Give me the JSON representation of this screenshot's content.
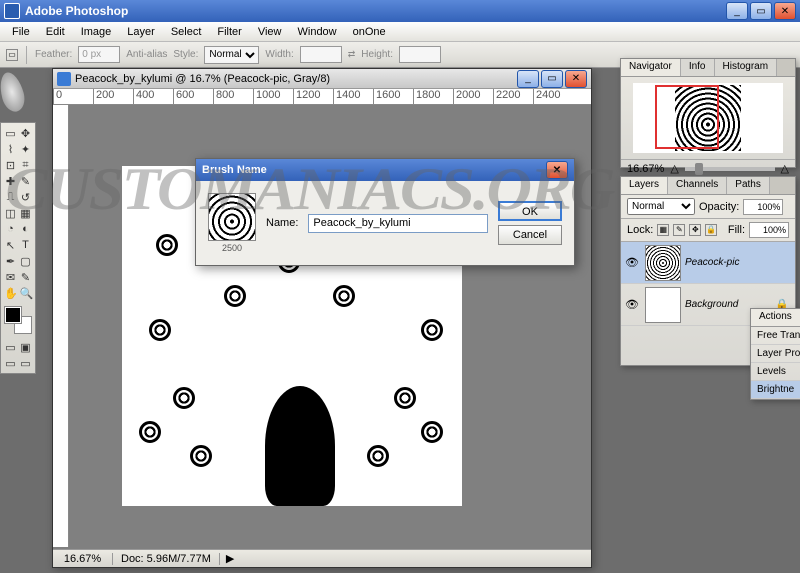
{
  "app": {
    "title": "Adobe Photoshop"
  },
  "menu": [
    "File",
    "Edit",
    "Image",
    "Layer",
    "Select",
    "Filter",
    "View",
    "Window",
    "onOne"
  ],
  "options": {
    "feather_label": "Feather:",
    "feather_value": "0 px",
    "antialias": "Anti-alias",
    "style_label": "Style:",
    "style_value": "Normal",
    "width_label": "Width:",
    "height_label": "Height:"
  },
  "document": {
    "title": "Peacock_by_kylumi @ 16.7% (Peacock-pic, Gray/8)",
    "ruler": [
      "0",
      "200",
      "400",
      "600",
      "800",
      "1000",
      "1200",
      "1400",
      "1600",
      "1800",
      "2000",
      "2200",
      "2400"
    ],
    "zoom": "16.67%",
    "docinfo": "Doc: 5.96M/7.77M"
  },
  "dialog": {
    "title": "Brush Name",
    "thumb_size": "2500",
    "name_label": "Name:",
    "name_value": "Peacock_by_kylumi",
    "ok": "OK",
    "cancel": "Cancel"
  },
  "nav": {
    "tabs": [
      "Navigator",
      "Info",
      "Histogram"
    ],
    "zoom": "16.67%"
  },
  "layers": {
    "tabs": [
      "Layers",
      "Channels",
      "Paths"
    ],
    "blend": "Normal",
    "opacity_label": "Opacity:",
    "opacity": "100%",
    "lock_label": "Lock:",
    "fill_label": "Fill:",
    "fill": "100%",
    "items": [
      {
        "name": "Peacock-pic"
      },
      {
        "name": "Background"
      }
    ]
  },
  "actions": {
    "tab": "Actions",
    "items": [
      "Free Tran",
      "Layer Pro",
      "Levels",
      "Brightne"
    ]
  },
  "watermark": "CUSTOMANIACS.ORG"
}
